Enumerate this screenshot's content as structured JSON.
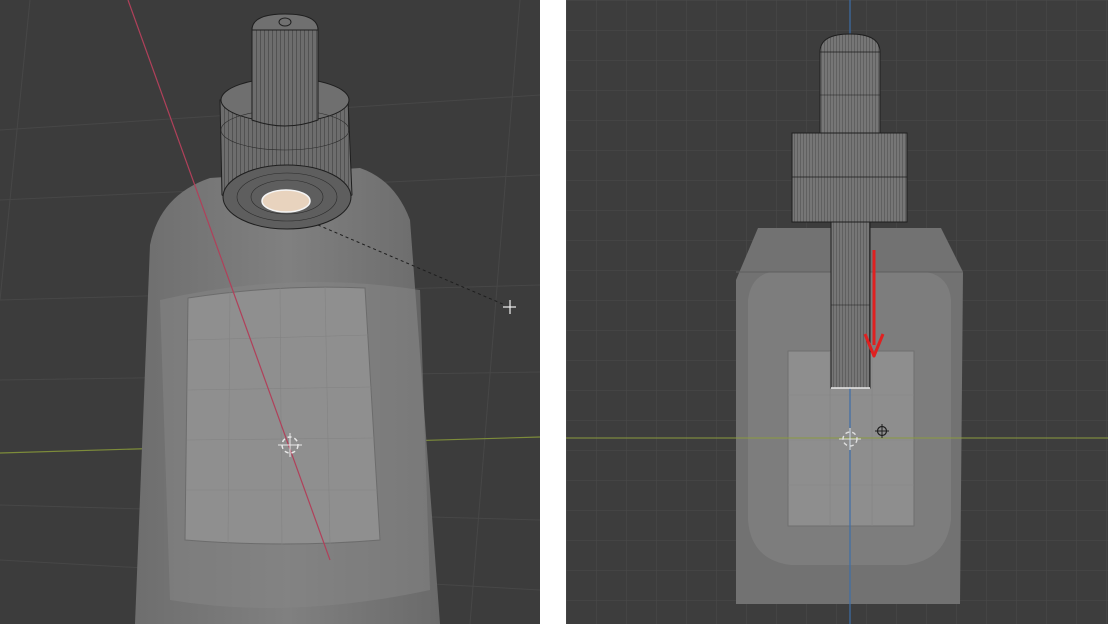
{
  "viewports": [
    {
      "name": "perspective-view",
      "view": "perspective"
    },
    {
      "name": "front-orthographic-view",
      "view": "orthographic-front"
    }
  ],
  "colors": {
    "background_left": "#3c3c3c",
    "background_right": "#3d3d3d",
    "grid_line": "#4a4a4a",
    "x_axis": "#b0405a",
    "y_axis": "#8a9a40",
    "z_axis": "#3d6ea8",
    "mesh_body": "#7a7a7a",
    "wireframe": "#1e1e1e",
    "selected_face": "#e8d3be",
    "arrow": "#e02020"
  },
  "icons": [
    "3d-cursor-icon",
    "mouse-crosshair-icon",
    "origin-point-icon",
    "down-arrow-icon"
  ]
}
